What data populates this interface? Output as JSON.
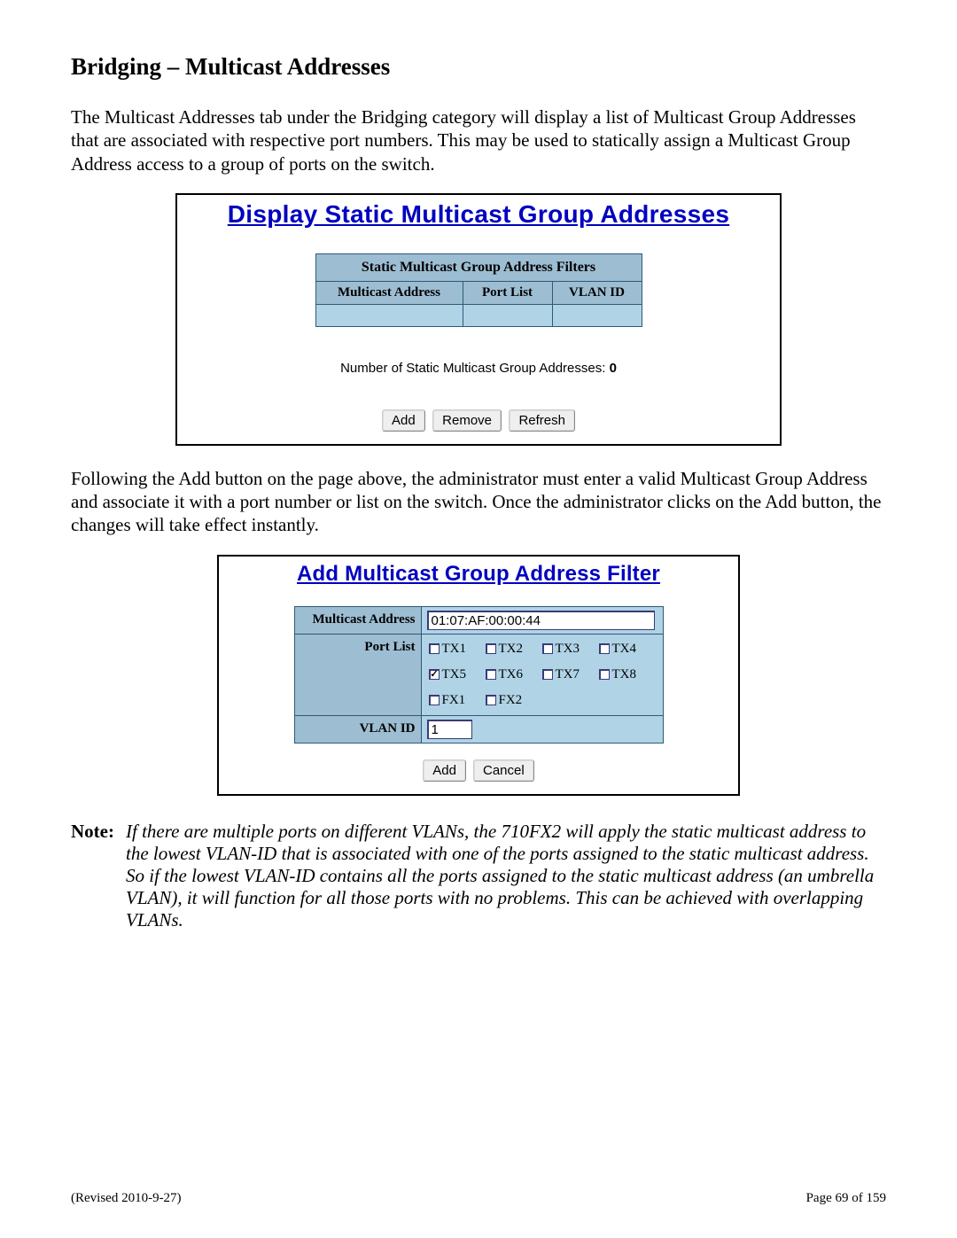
{
  "heading": "Bridging – Multicast Addresses",
  "para1": "The Multicast Addresses tab under the Bridging category will display a list of Multicast Group Addresses that are associated with respective port numbers.  This may be used to statically assign a Multicast Group Address access to a group of ports on the switch.",
  "para2": "Following the Add button on the page above, the administrator must enter a valid Multicast Group Address and associate it with a port number or list on the switch.  Once the administrator clicks on the Add button, the changes will take effect instantly.",
  "note_label": "Note:",
  "note_text": "If there are multiple ports on different VLANs, the 710FX2 will apply the static multicast address to the lowest VLAN-ID that is associated with one of the ports assigned to the static multicast address.  So if the lowest VLAN-ID contains all the ports assigned to the static multicast address (an umbrella VLAN), it will function for all those ports with no problems.  This can be achieved with overlapping VLANs.",
  "panel1": {
    "title": "Display Static Multicast Group Addresses",
    "table_header": "Static Multicast Group Address Filters",
    "col1": "Multicast Address",
    "col2": "Port List",
    "col3": "VLAN ID",
    "count_prefix": "Number of Static Multicast Group Addresses: ",
    "count_value": "0",
    "btn_add": "Add",
    "btn_remove": "Remove",
    "btn_refresh": "Refresh"
  },
  "panel2": {
    "title": "Add Multicast Group Address Filter",
    "row1_label": "Multicast Address",
    "row1_value": "01:07:AF:00:00:44",
    "row2_label": "Port List",
    "row3_label": "VLAN ID",
    "row3_value": "1",
    "ports": [
      {
        "name": "TX1",
        "checked": false
      },
      {
        "name": "TX2",
        "checked": false
      },
      {
        "name": "TX3",
        "checked": false
      },
      {
        "name": "TX4",
        "checked": false
      },
      {
        "name": "TX5",
        "checked": true
      },
      {
        "name": "TX6",
        "checked": false
      },
      {
        "name": "TX7",
        "checked": false
      },
      {
        "name": "TX8",
        "checked": false
      },
      {
        "name": "FX1",
        "checked": false
      },
      {
        "name": "FX2",
        "checked": false
      }
    ],
    "btn_add": "Add",
    "btn_cancel": "Cancel"
  },
  "footer": {
    "left": "(Revised 2010-9-27)",
    "right": "Page 69 of 159"
  }
}
